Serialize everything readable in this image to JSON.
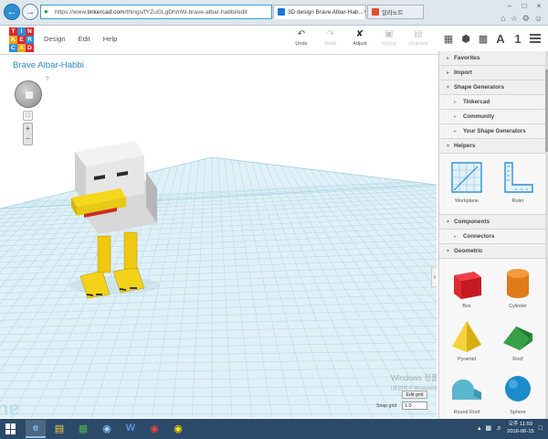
{
  "browser": {
    "url_prefix": "https://www.",
    "url_domain": "tinkercad.com",
    "url_path": "/things/fYZuGLgDhmW-brave-albar-habbi/edit",
    "tabs": [
      {
        "label": "3D design Brave Albar-Hab...",
        "active": true
      },
      {
        "label": "알라노트",
        "active": false
      }
    ]
  },
  "app": {
    "logo_letters": [
      "T",
      "I",
      "N",
      "K",
      "E",
      "R",
      "C",
      "A",
      "D"
    ],
    "menu": [
      "Design",
      "Edit",
      "Help"
    ],
    "toolbar": [
      {
        "label": "Undo",
        "icon": "undo-icon",
        "enabled": true
      },
      {
        "label": "Redo",
        "icon": "redo-icon",
        "enabled": false
      },
      {
        "label": "Adjust",
        "icon": "adjust-icon",
        "enabled": true
      },
      {
        "label": "Group",
        "icon": "group-icon",
        "enabled": false
      },
      {
        "label": "Ungroup",
        "icon": "ungroup-icon",
        "enabled": false
      }
    ],
    "view_tools": {
      "letter_a": "A",
      "number_one": "1"
    },
    "design_title": "Brave Albar-Habbi"
  },
  "workplane": {
    "help": "?",
    "edit_grid_label": "Edit grid",
    "snap_grid_label": "Snap grid",
    "snap_grid_value": "1.0",
    "watermark_title": "Windows 정품 인증",
    "watermark_sub": "[설정]에서 Windows를 정품 인증합니다."
  },
  "panel": {
    "sections": {
      "favorites": "Favorites",
      "import": "Import",
      "shape_generators": "Shape Generators",
      "helpers": "Helpers",
      "components": "Components",
      "geometric": "Geometric"
    },
    "generator_items": [
      "Tinkercad",
      "Community",
      "Your Shape Generators"
    ],
    "component_items": [
      "Connectors"
    ],
    "helper_shapes": [
      "Workplane",
      "Ruler"
    ],
    "geometric_shapes": [
      "Box",
      "Cylinder",
      "Pyramid",
      "Roof",
      "Round Roof",
      "Sphere"
    ]
  },
  "taskbar": {
    "time": "오후 11:59",
    "date": "2016-06-15"
  },
  "colors": {
    "accent": "#2b8acb",
    "grid_line": "#b9dbe9",
    "grid_bg": "#dff0f7",
    "box_red": "#d9202a",
    "cylinder_orange": "#e07b1c",
    "pyramid_yellow": "#f2c41f",
    "roof_green": "#36a045",
    "sphere_blue": "#1c8bc9",
    "round_roof_teal": "#5ab6cf"
  }
}
